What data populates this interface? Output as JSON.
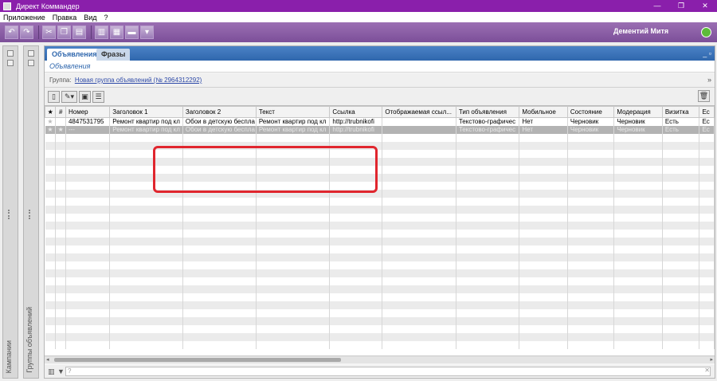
{
  "window": {
    "title": "Директ Коммандер",
    "controls": {
      "minimize": "—",
      "maximize": "❐",
      "close": "✕"
    }
  },
  "menu": [
    "Приложение",
    "Правка",
    "Вид",
    "?"
  ],
  "toolbar": {
    "user_name": "Дементий Митя"
  },
  "side_panels": {
    "campaigns": "Кампании",
    "groups": "Группы объявлений"
  },
  "tabs": [
    {
      "label": "Объявления",
      "active": true
    },
    {
      "label": "Фразы",
      "active": false
    }
  ],
  "tab_controls": "_ ▫",
  "subheader": "Объявления",
  "group": {
    "label": "Группа:",
    "link": "Новая группа объявлений (№ 2964312292)",
    "collapse": "»"
  },
  "grid": {
    "columns": [
      {
        "key": "star",
        "label": "★"
      },
      {
        "key": "flag",
        "label": "#"
      },
      {
        "key": "number",
        "label": "Номер"
      },
      {
        "key": "title1",
        "label": "Заголовок 1"
      },
      {
        "key": "title2",
        "label": "Заголовок 2"
      },
      {
        "key": "text",
        "label": "Текст"
      },
      {
        "key": "link",
        "label": "Ссылка"
      },
      {
        "key": "display_link",
        "label": "Отображаемая ссыл..."
      },
      {
        "key": "type",
        "label": "Тип объявления"
      },
      {
        "key": "mobile",
        "label": "Мобильное"
      },
      {
        "key": "state",
        "label": "Состояние"
      },
      {
        "key": "moderation",
        "label": "Модерация"
      },
      {
        "key": "vcard",
        "label": "Визитка"
      },
      {
        "key": "extra",
        "label": "Ес"
      }
    ],
    "rows": [
      {
        "star": "★",
        "flag": "",
        "number": "4847531795",
        "title1": "Ремонт квартир под кл",
        "title2": "Обои в детскую беспла",
        "text": "Ремонт квартир под кл",
        "link": "http://trubnikofi",
        "display_link": "",
        "type": "Текстово-графичес",
        "mobile": "Нет",
        "state": "Черновик",
        "moderation": "Черновик",
        "vcard": "Есть",
        "extra": "Ес"
      },
      {
        "star": "★",
        "flag": "★",
        "number": "---",
        "title1": "Ремонт квартир под кл",
        "title2": "Обои в детскую беспла",
        "text": "Ремонт квартир под кл",
        "link": "http://trubnikofi",
        "display_link": "",
        "type": "Текстово-графичес",
        "mobile": "Нет",
        "state": "Черновик",
        "moderation": "Черновик",
        "vcard": "Есть",
        "extra": "Ес"
      }
    ]
  },
  "filter": {
    "icon": "?",
    "clear": "✕"
  }
}
